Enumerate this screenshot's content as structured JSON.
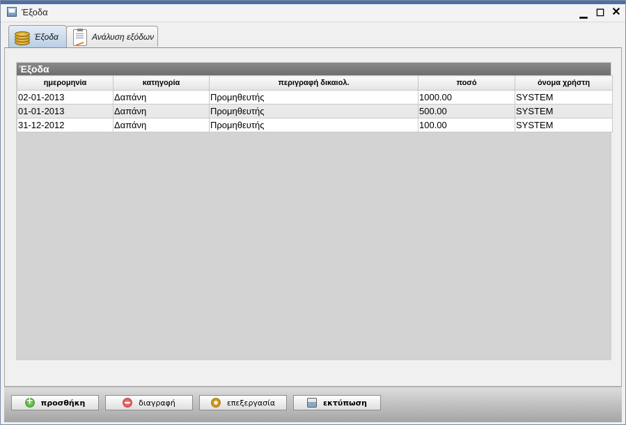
{
  "window": {
    "title": "Έξοδα",
    "min_glyph": "▁",
    "max_glyph": "☐",
    "close_glyph": "✕"
  },
  "tabs": [
    {
      "label": "Έξοδα",
      "icon": "coins-icon",
      "active": true
    },
    {
      "label": "Ανάλυση εξόδων",
      "icon": "report-icon",
      "active": false
    }
  ],
  "grid": {
    "caption": "Έξοδα",
    "columns": [
      "ημερομηνία",
      "κατηγορία",
      "περιγραφή δικαιολ.",
      "ποσό",
      "όνομα χρήστη"
    ],
    "rows": [
      [
        "02-01-2013",
        "Δαπάνη",
        "Προμηθευτής",
        "1000.00",
        "SYSTEM"
      ],
      [
        "01-01-2013",
        "Δαπάνη",
        "Προμηθευτής",
        "500.00",
        "SYSTEM"
      ],
      [
        "31-12-2012",
        "Δαπάνη",
        "Προμηθευτής",
        "100.00",
        "SYSTEM"
      ]
    ]
  },
  "buttons": {
    "add": "προσθήκη",
    "delete": "διαγραφή",
    "edit": "επεξεργασία",
    "print": "εκτύπωση"
  },
  "colors": {
    "accent": "#4d6fa6",
    "caption": "#7a7a7a"
  }
}
